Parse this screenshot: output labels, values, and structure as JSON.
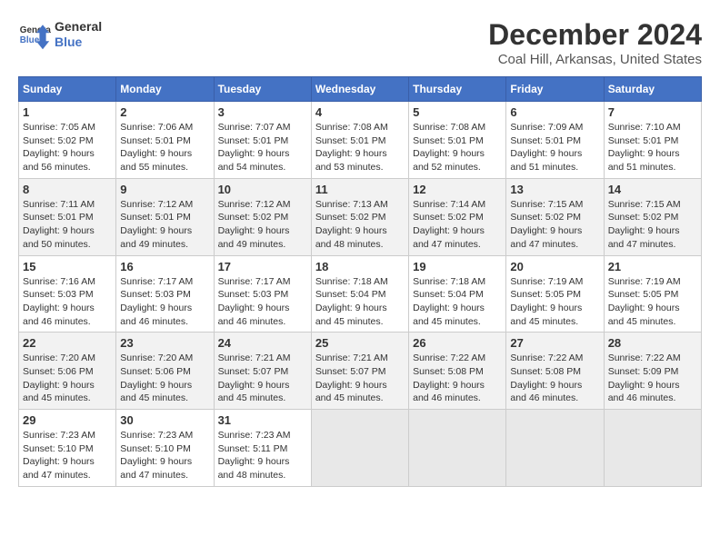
{
  "logo": {
    "line1": "General",
    "line2": "Blue"
  },
  "title": "December 2024",
  "location": "Coal Hill, Arkansas, United States",
  "weekdays": [
    "Sunday",
    "Monday",
    "Tuesday",
    "Wednesday",
    "Thursday",
    "Friday",
    "Saturday"
  ],
  "weeks": [
    [
      {
        "day": "1",
        "info": "Sunrise: 7:05 AM\nSunset: 5:02 PM\nDaylight: 9 hours\nand 56 minutes."
      },
      {
        "day": "2",
        "info": "Sunrise: 7:06 AM\nSunset: 5:01 PM\nDaylight: 9 hours\nand 55 minutes."
      },
      {
        "day": "3",
        "info": "Sunrise: 7:07 AM\nSunset: 5:01 PM\nDaylight: 9 hours\nand 54 minutes."
      },
      {
        "day": "4",
        "info": "Sunrise: 7:08 AM\nSunset: 5:01 PM\nDaylight: 9 hours\nand 53 minutes."
      },
      {
        "day": "5",
        "info": "Sunrise: 7:08 AM\nSunset: 5:01 PM\nDaylight: 9 hours\nand 52 minutes."
      },
      {
        "day": "6",
        "info": "Sunrise: 7:09 AM\nSunset: 5:01 PM\nDaylight: 9 hours\nand 51 minutes."
      },
      {
        "day": "7",
        "info": "Sunrise: 7:10 AM\nSunset: 5:01 PM\nDaylight: 9 hours\nand 51 minutes."
      }
    ],
    [
      {
        "day": "8",
        "info": "Sunrise: 7:11 AM\nSunset: 5:01 PM\nDaylight: 9 hours\nand 50 minutes."
      },
      {
        "day": "9",
        "info": "Sunrise: 7:12 AM\nSunset: 5:01 PM\nDaylight: 9 hours\nand 49 minutes."
      },
      {
        "day": "10",
        "info": "Sunrise: 7:12 AM\nSunset: 5:02 PM\nDaylight: 9 hours\nand 49 minutes."
      },
      {
        "day": "11",
        "info": "Sunrise: 7:13 AM\nSunset: 5:02 PM\nDaylight: 9 hours\nand 48 minutes."
      },
      {
        "day": "12",
        "info": "Sunrise: 7:14 AM\nSunset: 5:02 PM\nDaylight: 9 hours\nand 47 minutes."
      },
      {
        "day": "13",
        "info": "Sunrise: 7:15 AM\nSunset: 5:02 PM\nDaylight: 9 hours\nand 47 minutes."
      },
      {
        "day": "14",
        "info": "Sunrise: 7:15 AM\nSunset: 5:02 PM\nDaylight: 9 hours\nand 47 minutes."
      }
    ],
    [
      {
        "day": "15",
        "info": "Sunrise: 7:16 AM\nSunset: 5:03 PM\nDaylight: 9 hours\nand 46 minutes."
      },
      {
        "day": "16",
        "info": "Sunrise: 7:17 AM\nSunset: 5:03 PM\nDaylight: 9 hours\nand 46 minutes."
      },
      {
        "day": "17",
        "info": "Sunrise: 7:17 AM\nSunset: 5:03 PM\nDaylight: 9 hours\nand 46 minutes."
      },
      {
        "day": "18",
        "info": "Sunrise: 7:18 AM\nSunset: 5:04 PM\nDaylight: 9 hours\nand 45 minutes."
      },
      {
        "day": "19",
        "info": "Sunrise: 7:18 AM\nSunset: 5:04 PM\nDaylight: 9 hours\nand 45 minutes."
      },
      {
        "day": "20",
        "info": "Sunrise: 7:19 AM\nSunset: 5:05 PM\nDaylight: 9 hours\nand 45 minutes."
      },
      {
        "day": "21",
        "info": "Sunrise: 7:19 AM\nSunset: 5:05 PM\nDaylight: 9 hours\nand 45 minutes."
      }
    ],
    [
      {
        "day": "22",
        "info": "Sunrise: 7:20 AM\nSunset: 5:06 PM\nDaylight: 9 hours\nand 45 minutes."
      },
      {
        "day": "23",
        "info": "Sunrise: 7:20 AM\nSunset: 5:06 PM\nDaylight: 9 hours\nand 45 minutes."
      },
      {
        "day": "24",
        "info": "Sunrise: 7:21 AM\nSunset: 5:07 PM\nDaylight: 9 hours\nand 45 minutes."
      },
      {
        "day": "25",
        "info": "Sunrise: 7:21 AM\nSunset: 5:07 PM\nDaylight: 9 hours\nand 45 minutes."
      },
      {
        "day": "26",
        "info": "Sunrise: 7:22 AM\nSunset: 5:08 PM\nDaylight: 9 hours\nand 46 minutes."
      },
      {
        "day": "27",
        "info": "Sunrise: 7:22 AM\nSunset: 5:08 PM\nDaylight: 9 hours\nand 46 minutes."
      },
      {
        "day": "28",
        "info": "Sunrise: 7:22 AM\nSunset: 5:09 PM\nDaylight: 9 hours\nand 46 minutes."
      }
    ],
    [
      {
        "day": "29",
        "info": "Sunrise: 7:23 AM\nSunset: 5:10 PM\nDaylight: 9 hours\nand 47 minutes."
      },
      {
        "day": "30",
        "info": "Sunrise: 7:23 AM\nSunset: 5:10 PM\nDaylight: 9 hours\nand 47 minutes."
      },
      {
        "day": "31",
        "info": "Sunrise: 7:23 AM\nSunset: 5:11 PM\nDaylight: 9 hours\nand 48 minutes."
      },
      {
        "day": "",
        "info": ""
      },
      {
        "day": "",
        "info": ""
      },
      {
        "day": "",
        "info": ""
      },
      {
        "day": "",
        "info": ""
      }
    ]
  ]
}
